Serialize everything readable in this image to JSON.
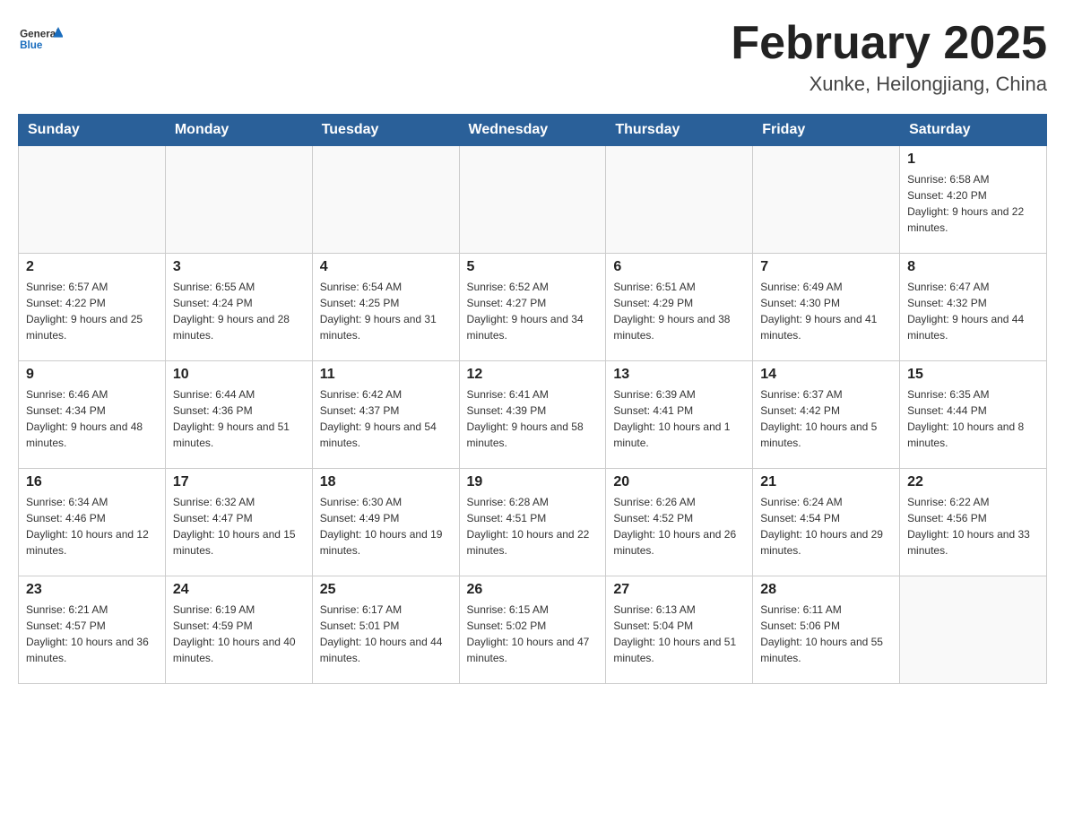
{
  "header": {
    "logo_general": "General",
    "logo_blue": "Blue",
    "month_title": "February 2025",
    "location": "Xunke, Heilongjiang, China"
  },
  "calendar": {
    "days_of_week": [
      "Sunday",
      "Monday",
      "Tuesday",
      "Wednesday",
      "Thursday",
      "Friday",
      "Saturday"
    ],
    "weeks": [
      [
        {
          "day": "",
          "info": ""
        },
        {
          "day": "",
          "info": ""
        },
        {
          "day": "",
          "info": ""
        },
        {
          "day": "",
          "info": ""
        },
        {
          "day": "",
          "info": ""
        },
        {
          "day": "",
          "info": ""
        },
        {
          "day": "1",
          "info": "Sunrise: 6:58 AM\nSunset: 4:20 PM\nDaylight: 9 hours and 22 minutes."
        }
      ],
      [
        {
          "day": "2",
          "info": "Sunrise: 6:57 AM\nSunset: 4:22 PM\nDaylight: 9 hours and 25 minutes."
        },
        {
          "day": "3",
          "info": "Sunrise: 6:55 AM\nSunset: 4:24 PM\nDaylight: 9 hours and 28 minutes."
        },
        {
          "day": "4",
          "info": "Sunrise: 6:54 AM\nSunset: 4:25 PM\nDaylight: 9 hours and 31 minutes."
        },
        {
          "day": "5",
          "info": "Sunrise: 6:52 AM\nSunset: 4:27 PM\nDaylight: 9 hours and 34 minutes."
        },
        {
          "day": "6",
          "info": "Sunrise: 6:51 AM\nSunset: 4:29 PM\nDaylight: 9 hours and 38 minutes."
        },
        {
          "day": "7",
          "info": "Sunrise: 6:49 AM\nSunset: 4:30 PM\nDaylight: 9 hours and 41 minutes."
        },
        {
          "day": "8",
          "info": "Sunrise: 6:47 AM\nSunset: 4:32 PM\nDaylight: 9 hours and 44 minutes."
        }
      ],
      [
        {
          "day": "9",
          "info": "Sunrise: 6:46 AM\nSunset: 4:34 PM\nDaylight: 9 hours and 48 minutes."
        },
        {
          "day": "10",
          "info": "Sunrise: 6:44 AM\nSunset: 4:36 PM\nDaylight: 9 hours and 51 minutes."
        },
        {
          "day": "11",
          "info": "Sunrise: 6:42 AM\nSunset: 4:37 PM\nDaylight: 9 hours and 54 minutes."
        },
        {
          "day": "12",
          "info": "Sunrise: 6:41 AM\nSunset: 4:39 PM\nDaylight: 9 hours and 58 minutes."
        },
        {
          "day": "13",
          "info": "Sunrise: 6:39 AM\nSunset: 4:41 PM\nDaylight: 10 hours and 1 minute."
        },
        {
          "day": "14",
          "info": "Sunrise: 6:37 AM\nSunset: 4:42 PM\nDaylight: 10 hours and 5 minutes."
        },
        {
          "day": "15",
          "info": "Sunrise: 6:35 AM\nSunset: 4:44 PM\nDaylight: 10 hours and 8 minutes."
        }
      ],
      [
        {
          "day": "16",
          "info": "Sunrise: 6:34 AM\nSunset: 4:46 PM\nDaylight: 10 hours and 12 minutes."
        },
        {
          "day": "17",
          "info": "Sunrise: 6:32 AM\nSunset: 4:47 PM\nDaylight: 10 hours and 15 minutes."
        },
        {
          "day": "18",
          "info": "Sunrise: 6:30 AM\nSunset: 4:49 PM\nDaylight: 10 hours and 19 minutes."
        },
        {
          "day": "19",
          "info": "Sunrise: 6:28 AM\nSunset: 4:51 PM\nDaylight: 10 hours and 22 minutes."
        },
        {
          "day": "20",
          "info": "Sunrise: 6:26 AM\nSunset: 4:52 PM\nDaylight: 10 hours and 26 minutes."
        },
        {
          "day": "21",
          "info": "Sunrise: 6:24 AM\nSunset: 4:54 PM\nDaylight: 10 hours and 29 minutes."
        },
        {
          "day": "22",
          "info": "Sunrise: 6:22 AM\nSunset: 4:56 PM\nDaylight: 10 hours and 33 minutes."
        }
      ],
      [
        {
          "day": "23",
          "info": "Sunrise: 6:21 AM\nSunset: 4:57 PM\nDaylight: 10 hours and 36 minutes."
        },
        {
          "day": "24",
          "info": "Sunrise: 6:19 AM\nSunset: 4:59 PM\nDaylight: 10 hours and 40 minutes."
        },
        {
          "day": "25",
          "info": "Sunrise: 6:17 AM\nSunset: 5:01 PM\nDaylight: 10 hours and 44 minutes."
        },
        {
          "day": "26",
          "info": "Sunrise: 6:15 AM\nSunset: 5:02 PM\nDaylight: 10 hours and 47 minutes."
        },
        {
          "day": "27",
          "info": "Sunrise: 6:13 AM\nSunset: 5:04 PM\nDaylight: 10 hours and 51 minutes."
        },
        {
          "day": "28",
          "info": "Sunrise: 6:11 AM\nSunset: 5:06 PM\nDaylight: 10 hours and 55 minutes."
        },
        {
          "day": "",
          "info": ""
        }
      ]
    ]
  }
}
